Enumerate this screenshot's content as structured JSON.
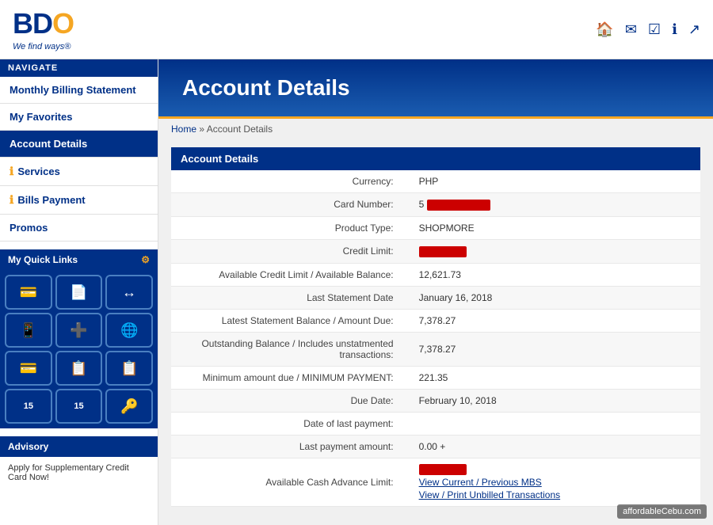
{
  "header": {
    "logo_bd": "BD",
    "logo_o": "O",
    "tagline": "We find ways®",
    "icons": [
      "home",
      "mail",
      "task",
      "info",
      "share"
    ]
  },
  "sidebar": {
    "nav_label": "NAVIGATE",
    "nav_items": [
      {
        "label": "Monthly Billing Statement",
        "active": false,
        "has_icon": false
      },
      {
        "label": "My Favorites",
        "active": false,
        "has_icon": false
      },
      {
        "label": "Account Details",
        "active": true,
        "has_icon": false
      },
      {
        "label": "Services",
        "active": false,
        "has_icon": true
      },
      {
        "label": "Bills Payment",
        "active": false,
        "has_icon": true
      },
      {
        "label": "Promos",
        "active": false,
        "has_icon": false
      }
    ],
    "quick_links_label": "My Quick Links",
    "quick_links_icons": [
      "💳",
      "📄",
      "↔️",
      "📱",
      "➕",
      "🌐",
      "💳",
      "📋",
      "📋",
      "15",
      "15",
      "🔑"
    ],
    "advisory_label": "Advisory",
    "advisory_text": "Apply for Supplementary Credit Card Now!"
  },
  "page_title": "Account Details",
  "breadcrumb": {
    "home": "Home",
    "separator": "»",
    "current": "Account Details"
  },
  "section_header": "Account Details",
  "account_details": [
    {
      "label": "Currency:",
      "value": "PHP",
      "redacted": false
    },
    {
      "label": "Card Number:",
      "value": "5",
      "redacted": true,
      "redacted_width": 80
    },
    {
      "label": "Product Type:",
      "value": "SHOPMORE",
      "redacted": false
    },
    {
      "label": "Credit Limit:",
      "value": "",
      "redacted": true,
      "redacted_width": 60
    },
    {
      "label": "Available Credit Limit / Available Balance:",
      "value": "12,621.73",
      "redacted": false
    },
    {
      "label": "Last Statement Date",
      "value": "January 16, 2018",
      "redacted": false
    },
    {
      "label": "Latest Statement Balance / Amount Due:",
      "value": "7,378.27",
      "redacted": false
    },
    {
      "label": "Outstanding Balance / Includes unstatmented transactions:",
      "value": "7,378.27",
      "redacted": false
    },
    {
      "label": "Minimum amount due / MINIMUM PAYMENT:",
      "value": "221.35",
      "redacted": false
    },
    {
      "label": "Due Date:",
      "value": "February 10, 2018",
      "redacted": false
    },
    {
      "label": "Date of last payment:",
      "value": "",
      "redacted": false
    },
    {
      "label": "Last payment amount:",
      "value": "0.00 +",
      "redacted": false
    },
    {
      "label": "Available Cash Advance Limit:",
      "value": "",
      "redacted": true,
      "redacted_width": 60,
      "has_links": true
    }
  ],
  "links": [
    "View Current / Previous MBS",
    "View / Print Unbilled Transactions"
  ],
  "watermark": "affordableCebu.com"
}
